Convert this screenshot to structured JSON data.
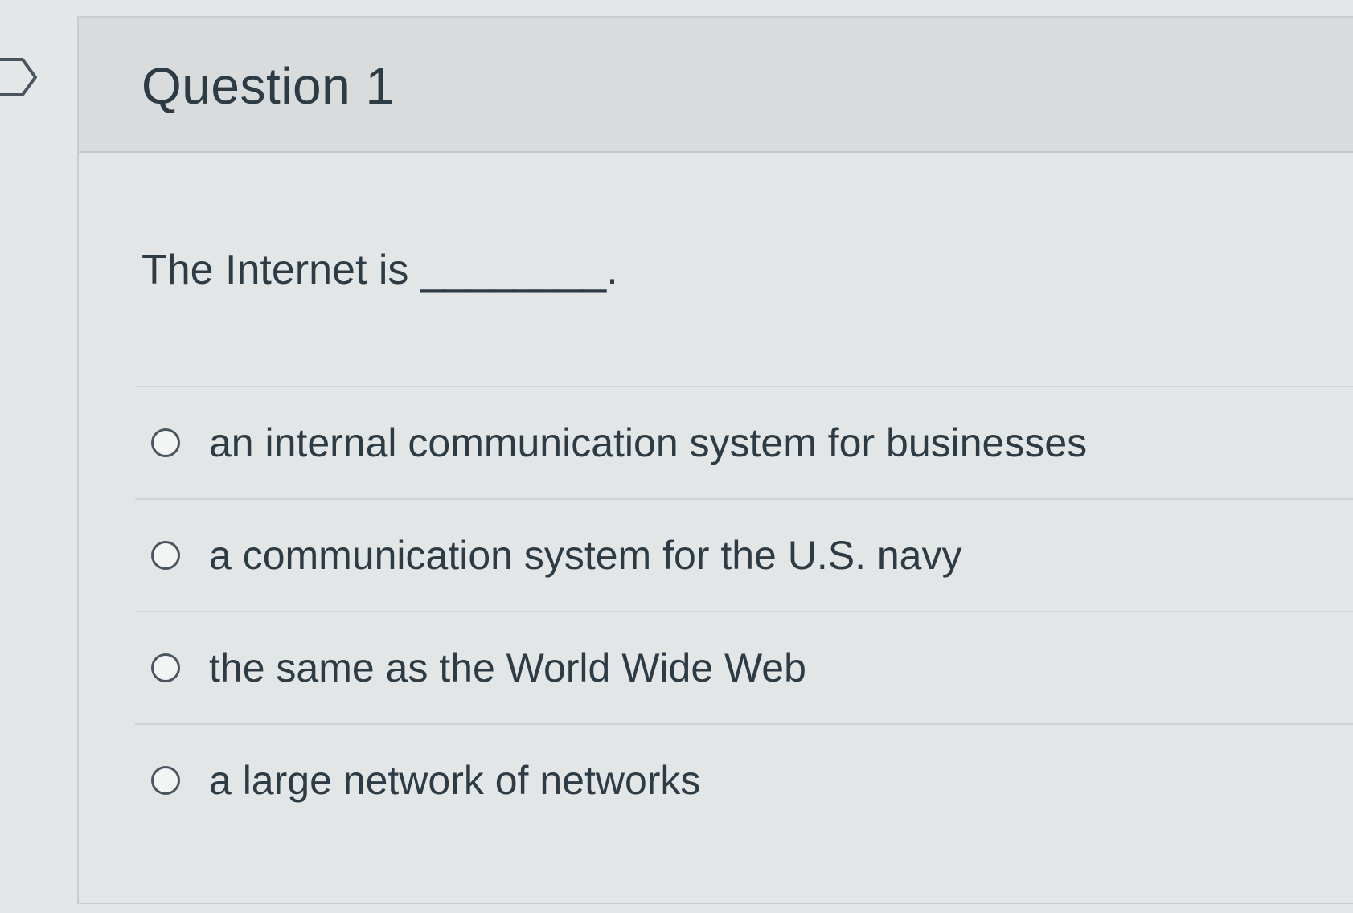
{
  "quiz": {
    "question_title": "Question 1",
    "question_text": "The Internet is ________.",
    "answers": [
      {
        "label": "an internal communication system for businesses",
        "selected": false
      },
      {
        "label": "a communication system for the U.S. navy",
        "selected": false
      },
      {
        "label": "the same as the World Wide Web",
        "selected": false
      },
      {
        "label": "a large network of networks",
        "selected": false
      }
    ]
  },
  "icons": {
    "bookmark": "bookmark-flag-icon",
    "radio": "radio-button-icon"
  },
  "colors": {
    "text": "#2d3b45",
    "header_bg": "#d9dcdc",
    "card_bg": "#e3e6e6"
  }
}
